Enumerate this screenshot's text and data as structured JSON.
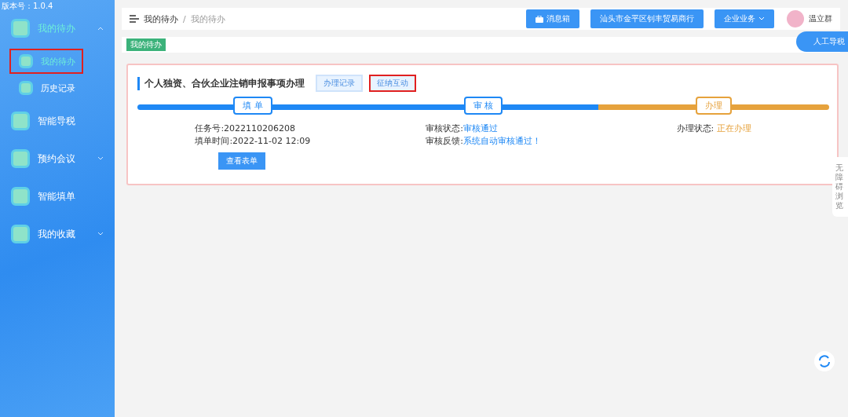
{
  "version": "版本号：1.0.4",
  "sidebar": {
    "items": [
      {
        "label": "我的待办",
        "expanded": true,
        "children": [
          {
            "label": "我的待办",
            "selected": true,
            "highlighted": true
          },
          {
            "label": "历史记录",
            "selected": false,
            "highlighted": false
          }
        ]
      },
      {
        "label": "智能导税"
      },
      {
        "label": "预约会议",
        "expanded": false
      },
      {
        "label": "智能填单"
      },
      {
        "label": "我的收藏",
        "expanded": false
      }
    ]
  },
  "breadcrumb": [
    "我的待办",
    "/",
    "我的待办"
  ],
  "header_buttons": [
    {
      "label": "消息箱",
      "kind": "icon"
    },
    {
      "label": "汕头市金平区钊丰贸易商行",
      "kind": "plain"
    },
    {
      "label": "企业业务",
      "kind": "dropdown"
    }
  ],
  "user": {
    "name": "温立群"
  },
  "page_tag": "我的待办",
  "guide_button": "人工导税",
  "task": {
    "title": "个人独资、合伙企业注销申报事项办理",
    "actions": [
      {
        "label": "办理记录",
        "highlighted": false
      },
      {
        "label": "征纳互动",
        "highlighted": true
      }
    ],
    "stages": [
      {
        "label": "填 单",
        "color": "#1e88f5",
        "lines": [
          {
            "label": "任务号:2022110206208"
          },
          {
            "label": "填单时间:2022-11-02 12:09"
          }
        ],
        "button": "查看表单"
      },
      {
        "label": "审 核",
        "color": "#1e88f5",
        "lines": [
          {
            "label": "审核状态:",
            "value": "审核通过"
          },
          {
            "label": "审核反馈:",
            "value": "系统自动审核通过！"
          }
        ]
      },
      {
        "label": "办理",
        "color": "#e6a23c",
        "lines": [
          {
            "label": "办理状态: ",
            "value": "正在办理"
          }
        ]
      }
    ]
  },
  "accessibility_label": "无障碍浏览"
}
